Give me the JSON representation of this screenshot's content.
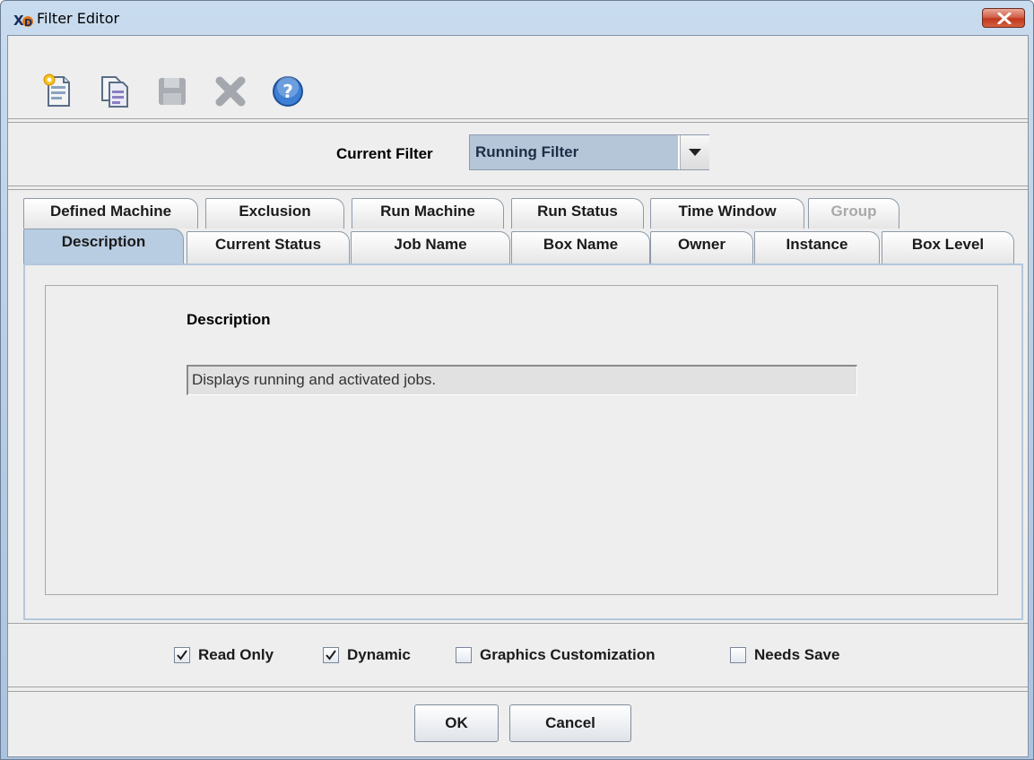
{
  "window": {
    "title": "Filter Editor"
  },
  "toolbar": {
    "buttons": [
      {
        "icon": "new-document-icon",
        "enabled": true
      },
      {
        "icon": "copy-document-icon",
        "enabled": true
      },
      {
        "icon": "save-icon",
        "enabled": false
      },
      {
        "icon": "delete-icon",
        "enabled": false
      },
      {
        "icon": "help-icon",
        "enabled": true
      }
    ]
  },
  "current_filter": {
    "label": "Current Filter",
    "value": "Running Filter"
  },
  "tabs": {
    "row1": [
      "Defined Machine",
      "Exclusion",
      "Run Machine",
      "Run Status",
      "Time Window",
      "Group"
    ],
    "row2": [
      "Description",
      "Current Status",
      "Job Name",
      "Box Name",
      "Owner",
      "Instance",
      "Box Level"
    ],
    "disabled": [
      "Group"
    ],
    "selected": "Description"
  },
  "description": {
    "label": "Description",
    "value": "Displays running and activated jobs."
  },
  "options": [
    {
      "label": "Read Only",
      "checked": true
    },
    {
      "label": "Dynamic",
      "checked": true
    },
    {
      "label": "Graphics Customization",
      "checked": false
    },
    {
      "label": "Needs Save",
      "checked": false
    }
  ],
  "buttons": {
    "ok": "OK",
    "cancel": "Cancel"
  },
  "colors": {
    "selected_tab": "#b9cde2",
    "combo_highlight": "#b6c6d9",
    "close_button": "#c1381e"
  }
}
